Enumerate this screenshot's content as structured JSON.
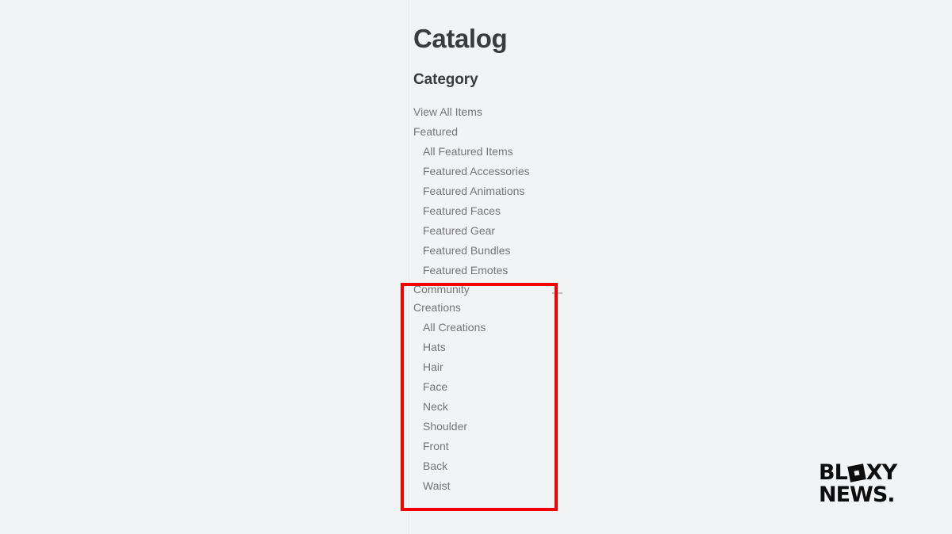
{
  "page": {
    "title": "Catalog",
    "category_heading": "Category"
  },
  "nav": {
    "view_all_label": "View All Items",
    "featured_group_label": "Featured",
    "featured_items": [
      "All Featured Items",
      "Featured Accessories",
      "Featured Animations",
      "Featured Faces",
      "Featured Gear",
      "Featured Bundles",
      "Featured Emotes"
    ],
    "community_group_line1": "Community",
    "community_group_line2": "Creations",
    "collapse_icon": "minus-icon",
    "community_items": [
      "All Creations",
      "Hats",
      "Hair",
      "Face",
      "Neck",
      "Shoulder",
      "Front",
      "Back",
      "Waist"
    ]
  },
  "annotation": {
    "box_color": "#f40000"
  },
  "watermark": {
    "line1_pre": "BL",
    "line1_o": "O",
    "line1_post": "XY",
    "line2": "NEWS."
  },
  "colors": {
    "background": "#f2f3f5",
    "heading_text": "#393b3d",
    "nav_text": "#757575",
    "divider": "#e9eaec",
    "logo": "#0d0d0d"
  }
}
